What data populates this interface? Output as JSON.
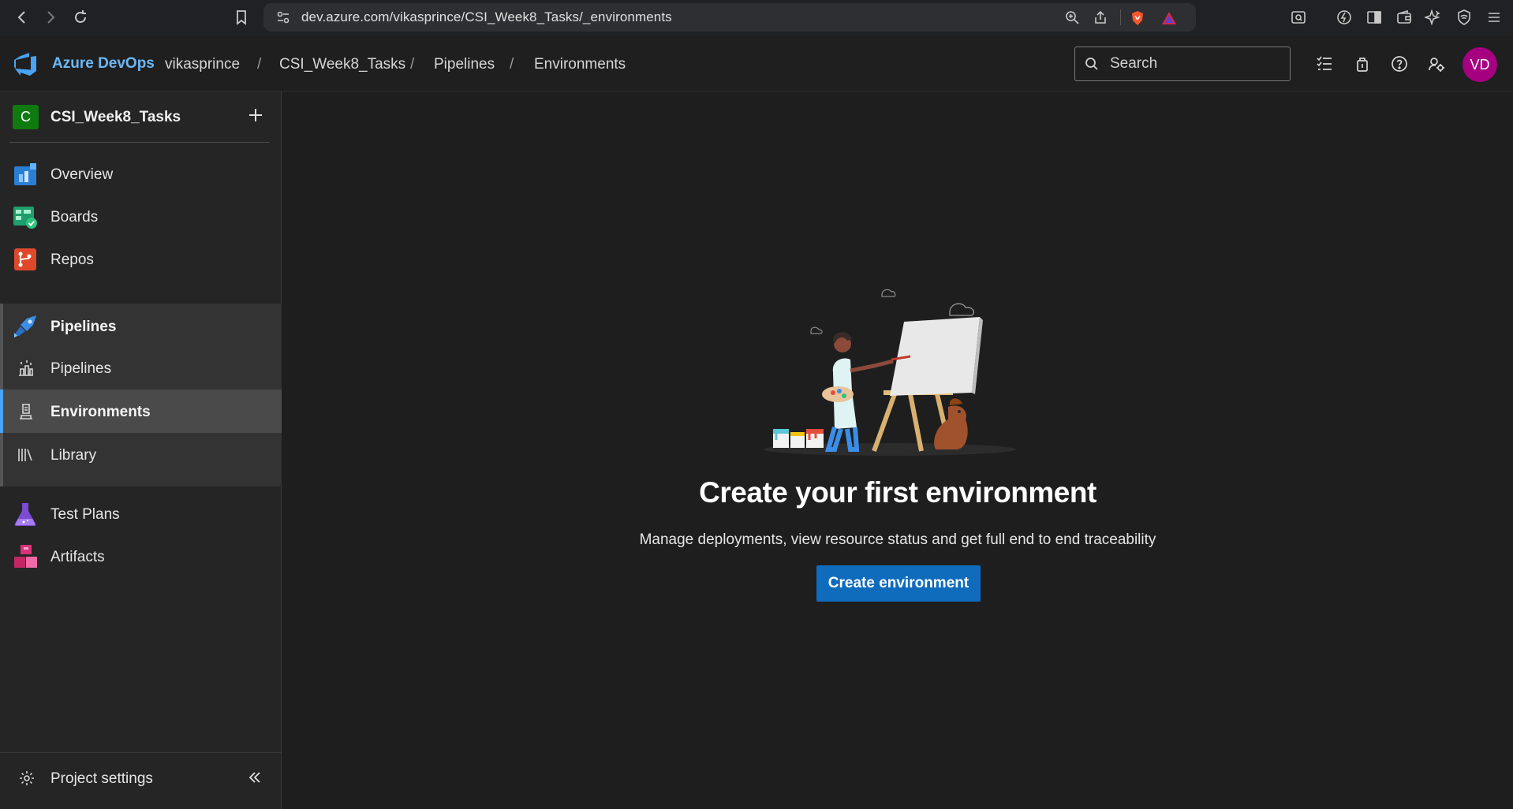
{
  "browser": {
    "url": "dev.azure.com/vikasprince/CSI_Week8_Tasks/_environments"
  },
  "header": {
    "brand": "Azure DevOps",
    "breadcrumbs": [
      "vikasprince",
      "CSI_Week8_Tasks",
      "Pipelines",
      "Environments"
    ],
    "separator": "/",
    "search_placeholder": "Search",
    "avatar_initials": "VD",
    "avatar_color": "#a4007f"
  },
  "sidebar": {
    "project_initial": "C",
    "project_name": "CSI_Week8_Tasks",
    "items": [
      {
        "label": "Overview",
        "icon": "overview-icon"
      },
      {
        "label": "Boards",
        "icon": "boards-icon"
      },
      {
        "label": "Repos",
        "icon": "repos-icon"
      },
      {
        "label": "Pipelines",
        "icon": "pipelines-icon"
      },
      {
        "label": "Test Plans",
        "icon": "test-plans-icon"
      },
      {
        "label": "Artifacts",
        "icon": "artifacts-icon"
      }
    ],
    "pipeline_subitems": [
      {
        "label": "Pipelines",
        "icon": "pipelines-sub-icon"
      },
      {
        "label": "Environments",
        "icon": "environments-icon",
        "active": true
      },
      {
        "label": "Library",
        "icon": "library-icon"
      }
    ],
    "settings_label": "Project settings"
  },
  "main": {
    "title": "Create your first environment",
    "description": "Manage deployments, view resource status and get full end to end traceability",
    "button_label": "Create environment",
    "accent_color": "#0f6cbd"
  }
}
